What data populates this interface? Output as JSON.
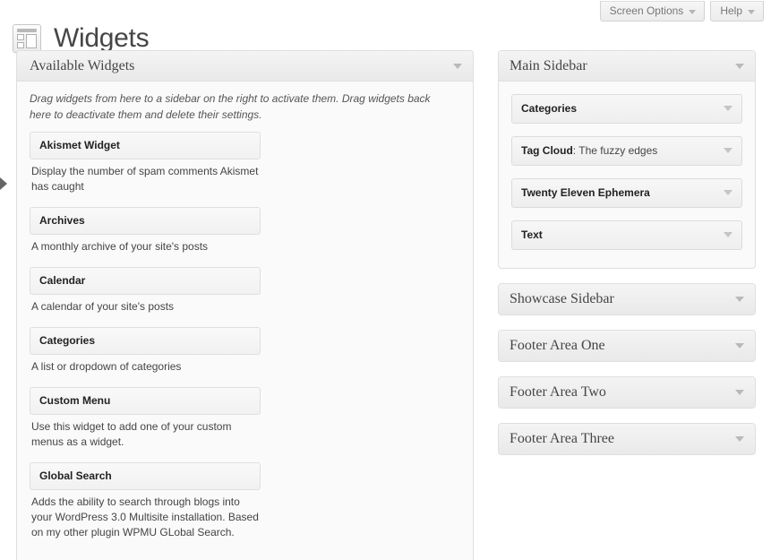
{
  "header": {
    "title": "Widgets",
    "icon": "widgets-icon"
  },
  "meta_buttons": [
    {
      "label": "Screen Options",
      "icon": "chevron-down-icon"
    },
    {
      "label": "Help",
      "icon": "chevron-down-icon"
    }
  ],
  "available_panel": {
    "title": "Available Widgets",
    "toggle_icon": "chevron-down-icon",
    "description": "Drag widgets from here to a sidebar on the right to activate them. Drag widgets back here to deactivate them and delete their settings.",
    "widgets": [
      {
        "name": "Akismet Widget",
        "description": "Display the number of spam comments Akismet has caught"
      },
      {
        "name": "Archives",
        "description": "A monthly archive of your site's posts"
      },
      {
        "name": "Calendar",
        "description": "A calendar of your site's posts"
      },
      {
        "name": "Categories",
        "description": "A list or dropdown of categories"
      },
      {
        "name": "Custom Menu",
        "description": "Use this widget to add one of your custom menus as a widget."
      },
      {
        "name": "Global Search",
        "description": "Adds the ability to search through blogs into your WordPress 3.0 Multisite installation. Based on my other plugin WPMU GLobal Search."
      }
    ]
  },
  "sidebars": [
    {
      "title": "Main Sidebar",
      "state": "open",
      "toggle_icon": "chevron-down-icon",
      "widgets": [
        {
          "name": "Categories",
          "instance": "",
          "toggle_icon": "chevron-down-icon"
        },
        {
          "name": "Tag Cloud",
          "instance": ": The fuzzy edges",
          "toggle_icon": "chevron-down-icon"
        },
        {
          "name": "Twenty Eleven Ephemera",
          "instance": "",
          "toggle_icon": "chevron-down-icon"
        },
        {
          "name": "Text",
          "instance": "",
          "toggle_icon": "chevron-down-icon"
        }
      ]
    },
    {
      "title": "Showcase Sidebar",
      "state": "collapsed",
      "toggle_icon": "chevron-down-icon",
      "widgets": []
    },
    {
      "title": "Footer Area One",
      "state": "collapsed",
      "toggle_icon": "chevron-down-icon",
      "widgets": []
    },
    {
      "title": "Footer Area Two",
      "state": "collapsed",
      "toggle_icon": "chevron-down-icon",
      "widgets": []
    },
    {
      "title": "Footer Area Three",
      "state": "collapsed",
      "toggle_icon": "chevron-down-icon",
      "widgets": []
    }
  ],
  "flyout": {
    "icon": "triangle-right-icon"
  },
  "colors": {
    "page_bg": "#ffffff",
    "panel_bg": "#fafafa",
    "panel_border": "#dfdfdf",
    "head_gradient_top": "#f4f4f4",
    "head_gradient_bottom": "#e9e9e9",
    "title_text": "#464646",
    "body_text": "#444444"
  }
}
